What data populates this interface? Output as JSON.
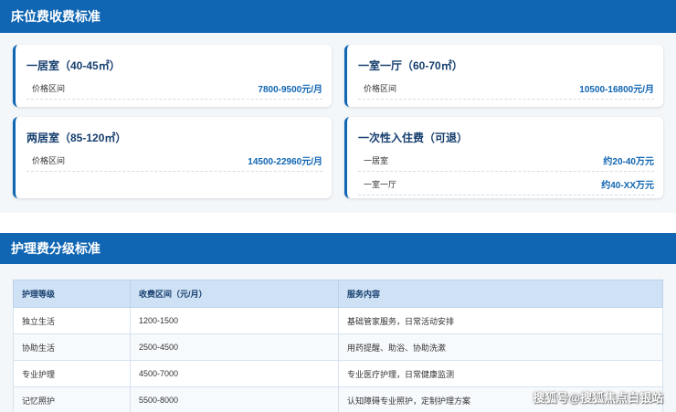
{
  "bed_fee": {
    "title": "床位费收费标准",
    "cards": [
      {
        "title": "一居室（40-45㎡）",
        "rows": [
          {
            "label": "价格区间",
            "value": "7800-9500元/月"
          }
        ]
      },
      {
        "title": "一室一厅（60-70㎡）",
        "rows": [
          {
            "label": "价格区间",
            "value": "10500-16800元/月"
          }
        ]
      },
      {
        "title": "两居室（85-120㎡）",
        "rows": [
          {
            "label": "价格区间",
            "value": "14500-22960元/月"
          }
        ]
      },
      {
        "title": "一次性入住费（可退）",
        "rows": [
          {
            "label": "一居室",
            "value": "约20-40万元"
          },
          {
            "label": "一室一厅",
            "value": "约40-XX万元"
          }
        ]
      }
    ]
  },
  "care_fee": {
    "title": "护理费分级标准",
    "columns": [
      "护理等级",
      "收费区间（元/月）",
      "服务内容"
    ],
    "rows": [
      [
        "独立生活",
        "1200-1500",
        "基础管家服务，日常活动安排"
      ],
      [
        "协助生活",
        "2500-4500",
        "用药提醒、助浴、协助洗漱"
      ],
      [
        "专业护理",
        "4500-7000",
        "专业医疗护理，日常健康监测"
      ],
      [
        "记忆照护",
        "5500-8000",
        "认知障碍专业照护，定制护理方案"
      ]
    ]
  },
  "watermark": "搜狐号@搜狐焦点白银站"
}
